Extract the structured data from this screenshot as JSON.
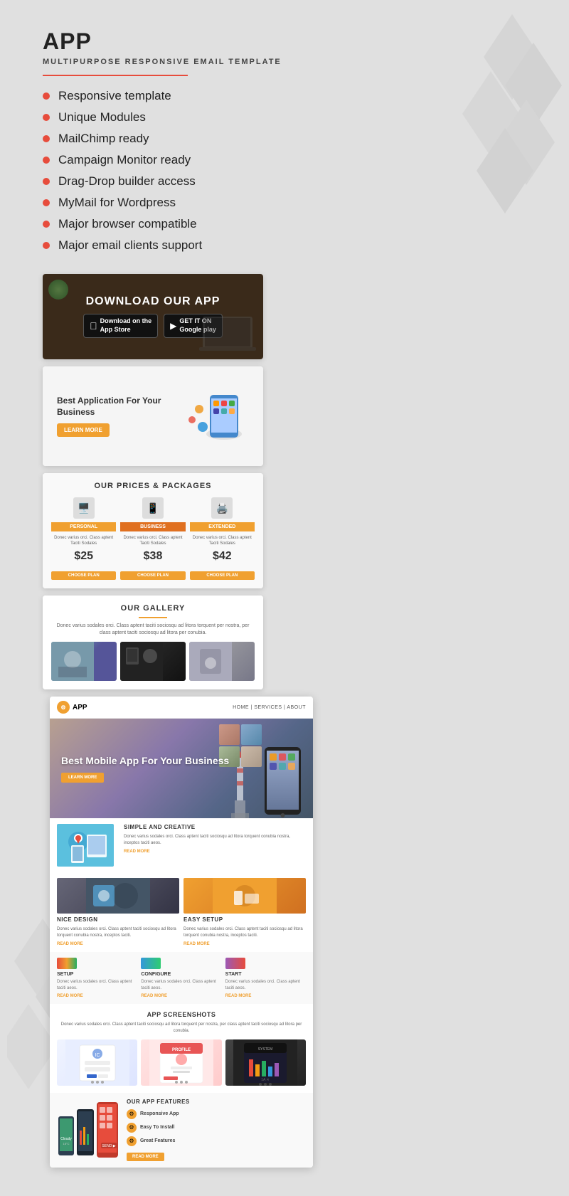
{
  "title": "APP",
  "subtitle": "MULTIPURPOSE RESPONSIVE EMAIL TEMPLATE",
  "features": [
    "Responsive template",
    "Unique Modules",
    "MailChimp ready",
    "Campaign Monitor ready",
    "Drag-Drop builder access",
    "MyMail for Wordpress",
    "Major browser compatible",
    "Major email clients support"
  ],
  "download_card": {
    "title": "DOWNLOAD OUR APP",
    "appstore_label": "Download on the",
    "appstore_name": "App Store",
    "google_label": "GET IT ON",
    "google_name": "Google play"
  },
  "best_app": {
    "title": "Best Application For Your Business",
    "cta": "LEARN MORE"
  },
  "pricing": {
    "title": "OUR PRICES & PACKAGES",
    "plans": [
      {
        "name": "PERSONAL",
        "desc": "Donec varius orci. Class aptent Taciti Sodales",
        "price": "$25",
        "cta": "CHOOSE PLAN"
      },
      {
        "name": "BUSINESS",
        "desc": "Donec varius orci. Class aptent Taciti Sodales",
        "price": "$38",
        "cta": "CHOOSE PLAN"
      },
      {
        "name": "EXTENDED",
        "desc": "Donec varius orci. Class aptent Taciti Sodales",
        "price": "$42",
        "cta": "CHOOSE PLAN"
      }
    ]
  },
  "gallery": {
    "title": "OUR GALLERY",
    "desc": "Donec varius sodales orci. Class aptent taciti sociosqu ad litora torquent per nostra, per class aptent taciti sociosqu ad litora per conubia."
  },
  "email_template": {
    "logo": "APP",
    "nav": "HOME | SERVICES | ABOUT",
    "hero": {
      "title": "Best Mobile App For Your Business",
      "cta": "LEARN MORE"
    },
    "simple_creative": {
      "title": "SIMPLE AND CREATIVE",
      "desc": "Donec varius sodales orci. Class aptent taciti sociosqu ad litora torquent conubia nostra, inceptos taciti aeos.",
      "read_more": "READ MORE"
    },
    "two_col": [
      {
        "title": "NICE DESIGN",
        "desc": "Donec varius sodales orci. Class aptent taciti sociosqu ad litora torquent conubia nostra, inceptos taciti.",
        "read_more": "READ MORE"
      },
      {
        "title": "EASY SETUP",
        "desc": "Donec varius sodales orci. Class aptent taciti sociosqu ad litora torquent conubia nostra, inceptos taciti.",
        "read_more": "READ MORE"
      }
    ],
    "three_col": [
      {
        "label": "SETUP",
        "desc": "Donec varius sodales orci. Class aptent taciti aeos.",
        "read_more": "READ MORE"
      },
      {
        "label": "CONFIGURE",
        "desc": "Donec varius sodales orci. Class aptent taciti aeos.",
        "read_more": "READ MORE"
      },
      {
        "label": "START",
        "desc": "Donec varius sodales orci. Class aptent taciti aeos.",
        "read_more": "READ MORE"
      }
    ],
    "screenshots": {
      "title": "APP SCREENSHOTS",
      "desc": "Donec varius sodales orci. Class aptent taciti sociosqu ad litora torquent per nostra, per class aptent taciti sociosqu ad litora per conubia."
    },
    "app_features": {
      "title": "OUR APP FEATURES",
      "items": [
        "Responsive App",
        "Easy To Install",
        "Great Features"
      ],
      "cta": "READ MORE"
    }
  }
}
